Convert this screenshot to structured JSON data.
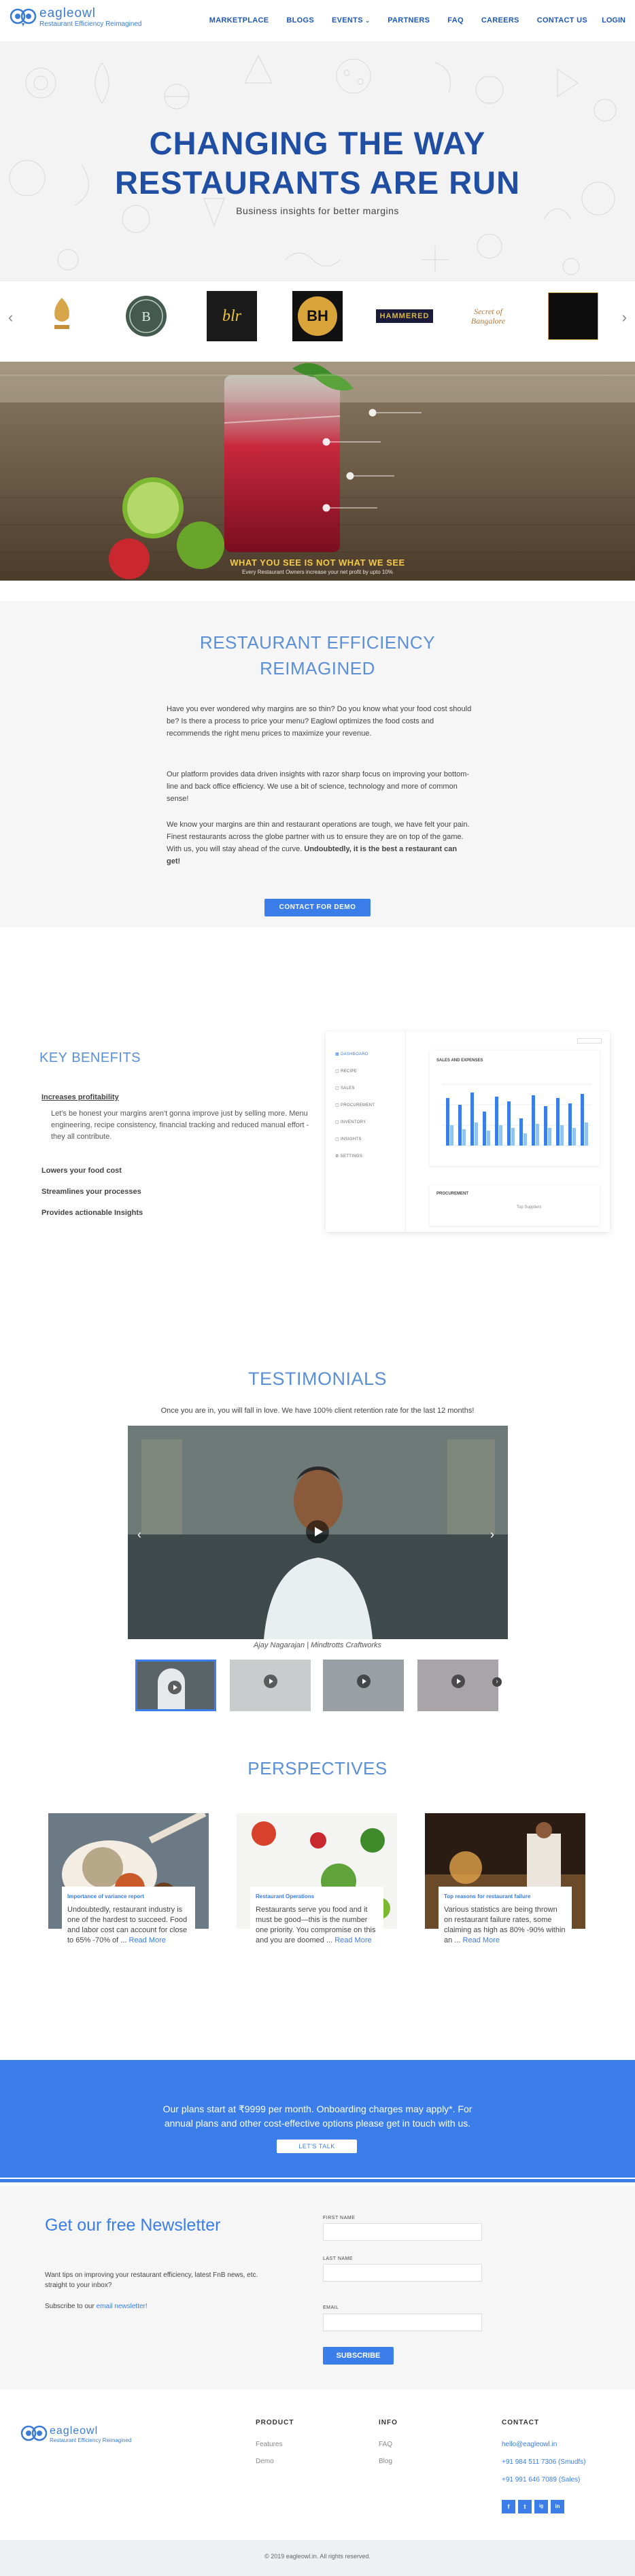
{
  "nav": {
    "logo_name": "eagleowl",
    "logo_tagline": "Restaurant Efficiency Reimagined",
    "items": [
      "MARKETPLACE",
      "BLOGS",
      "EVENTS",
      "PARTNERS",
      "FAQ",
      "CAREERS",
      "CONTACT US"
    ],
    "login": "LOGIN"
  },
  "hero": {
    "title_line1": "CHANGING THE WAY",
    "title_line2": "RESTAURANTS ARE RUN",
    "subtitle": "Business insights for better margins"
  },
  "clients": {
    "logos": [
      "client-logo-1",
      "client-logo-2",
      "blr",
      "BH",
      "HAMMERED",
      "Secret of Bangalore",
      "client-logo-7"
    ],
    "prev_icon": "‹",
    "next_icon": "›"
  },
  "banner": {
    "caption": "WHAT YOU SEE IS NOT WHAT WE SEE",
    "sub_caption": "Every Restaurant Owners increase your net profit by upto 10%"
  },
  "reimagined": {
    "title_line1": "RESTAURANT EFFICIENCY",
    "title_line2": "REIMAGINED",
    "para1": "Have you ever wondered why margins are so thin? Do you know what your food cost should be? Is there a process to price your menu? Eaglowl optimizes the food costs and recommends the right menu prices to maximize your revenue.",
    "para2": "Our platform provides data driven insights with razor sharp focus on improving your bottom-line and back office efficiency. We use a bit of science, technology and more of common sense!",
    "para3": "We know your margins are thin and restaurant operations are tough, we have felt your pain. Finest restaurants across the globe partner with us to ensure they are on top of the game. With us, you will stay ahead of the curve.",
    "para3_bold": "Undoubtedly, it is the best a restaurant can get!",
    "demo_button": "CONTACT FOR DEMO"
  },
  "benefits": {
    "title": "KEY BENEFITS",
    "items": [
      "Increases profitability",
      "Lowers your food cost",
      "Streamlines your processes",
      "Provides actionable Insights"
    ],
    "description": "Let's be honest your margins aren't gonna improve just by selling more. Menu engineering, recipe consistency, financial tracking and reduced manual effort - they all contribute."
  },
  "dashboard": {
    "sidebar": [
      "DASHBOARD",
      "RECIPE",
      "SALES",
      "PROCUREMENT",
      "INVENTORY",
      "INSIGHTS",
      "SETTINGS"
    ],
    "chart_title": "SALES AND EXPENSES",
    "card2_title": "PROCUREMENT",
    "card2_sub": "Top Suppliers"
  },
  "testimonials": {
    "title": "TESTIMONIALS",
    "subtitle": "Once you are in, you will fall in love. We have 100% client retention rate for the last 12 months!",
    "video_caption": "Ajay Nagarajan | Mindtrotts Craftworks"
  },
  "perspectives": {
    "title": "PERSPECTIVES",
    "cards": [
      {
        "title": "Importance of variance report",
        "desc": "Undoubtedly, restaurant industry is one of the hardest to succeed. Food and labor cost can account for close to 65% -70% of ...",
        "more": "Read More"
      },
      {
        "title": "Restaurant Operations",
        "desc": "Restaurants serve you food and it must be good—this is the number one priority. You compromise on this and you are doomed ...",
        "more": "Read More"
      },
      {
        "title": "Top reasons for restaurant failure",
        "desc": "Various statistics are being thrown on restaurant failure rates, some claiming as high as 80% -90% within an ...",
        "more": "Read More"
      }
    ]
  },
  "plans": {
    "line1": "Our plans start at ₹9999 per month. Onboarding charges may apply*. For",
    "line2": "annual plans and other cost-effective options please get in touch with us.",
    "button": "LET'S TALK"
  },
  "newsletter": {
    "title": "Get our free Newsletter",
    "text1": "Want tips on improving your restaurant efficiency, latest FnB news, etc. straight to your inbox?",
    "text2_pre": "Subscribe to our",
    "text2_link": "email newsletter!",
    "first_name": "FIRST NAME",
    "last_name": "LAST NAME",
    "email": "EMAIL",
    "button": "SUBSCRIBE"
  },
  "footer": {
    "product_heading": "PRODUCT",
    "product_links": [
      "Features",
      "Demo"
    ],
    "info_heading": "INFO",
    "info_links": [
      "FAQ",
      "Blog"
    ],
    "contact_heading": "CONTACT",
    "contact_email": "hello@eagleowl.in",
    "contact_phone1": "+91 984 511 7306 (Smudfs)",
    "contact_phone2": "+91 991 646 7089 (Sales)",
    "social": [
      "f",
      "t",
      "ig",
      "in"
    ],
    "copyright": "© 2019 eagleowl.in. All rights reserved."
  },
  "colors": {
    "primary": "#3b7de9",
    "title_blue": "#1f4ea3",
    "light_blue": "#5b8fd6"
  }
}
